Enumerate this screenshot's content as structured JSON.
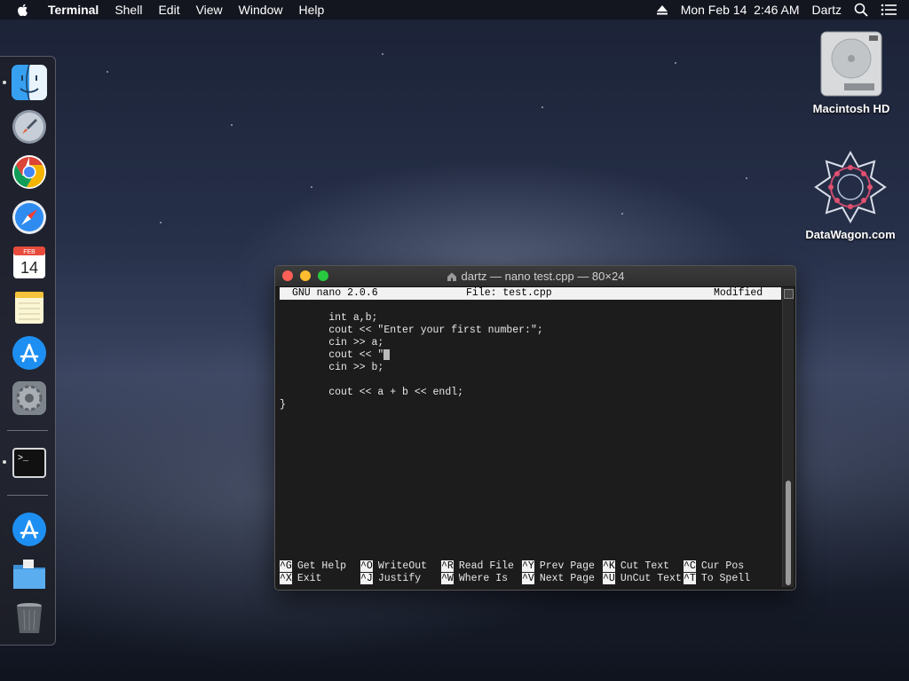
{
  "menubar": {
    "app_name": "Terminal",
    "menus": [
      "Shell",
      "Edit",
      "View",
      "Window",
      "Help"
    ],
    "datetime": "Mon Feb 14  2:46 AM",
    "user": "Dartz"
  },
  "desktop": {
    "icons": [
      {
        "label": "Macintosh HD"
      },
      {
        "label": "DataWagon.com"
      }
    ]
  },
  "dock": {
    "calendar_month": "FEB",
    "calendar_day": "14"
  },
  "window": {
    "title": "dartz — nano test.cpp — 80×24",
    "nano": {
      "version": "GNU nano 2.0.6",
      "file": "File: test.cpp",
      "status": "Modified",
      "code_lines": [
        "        int a,b;",
        "        cout << \"Enter your first number:\";",
        "        cin >> a;",
        "        cout << \"",
        "        cin >> b;",
        "",
        "        cout << a + b << endl;",
        "}"
      ],
      "shortcuts_row1": [
        {
          "key": "^G",
          "label": "Get Help"
        },
        {
          "key": "^O",
          "label": "WriteOut"
        },
        {
          "key": "^R",
          "label": "Read File"
        },
        {
          "key": "^Y",
          "label": "Prev Page"
        },
        {
          "key": "^K",
          "label": "Cut Text"
        },
        {
          "key": "^C",
          "label": "Cur Pos"
        }
      ],
      "shortcuts_row2": [
        {
          "key": "^X",
          "label": "Exit"
        },
        {
          "key": "^J",
          "label": "Justify"
        },
        {
          "key": "^W",
          "label": "Where Is"
        },
        {
          "key": "^V",
          "label": "Next Page"
        },
        {
          "key": "^U",
          "label": "UnCut Text"
        },
        {
          "key": "^T",
          "label": "To Spell"
        }
      ]
    }
  },
  "colors": {
    "close": "#fe5f57",
    "minimize": "#febc2e",
    "maximize": "#28c840"
  }
}
